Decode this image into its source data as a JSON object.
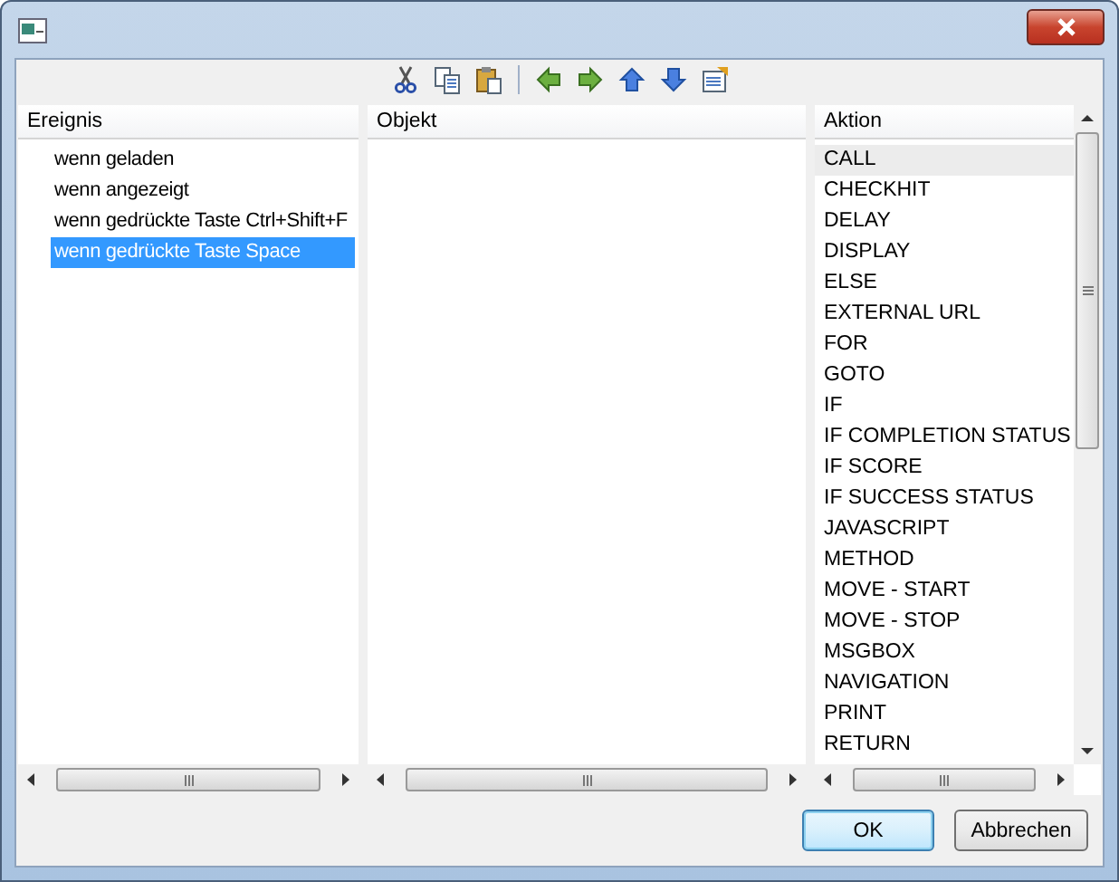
{
  "toolbar": [
    {
      "kind": "cut"
    },
    {
      "kind": "copy"
    },
    {
      "kind": "paste"
    },
    {
      "kind": "separator"
    },
    {
      "kind": "left"
    },
    {
      "kind": "right"
    },
    {
      "kind": "up"
    },
    {
      "kind": "down"
    },
    {
      "kind": "properties"
    }
  ],
  "events": {
    "header": "Ereignis",
    "items": [
      {
        "label": "wenn geladen",
        "selected": false
      },
      {
        "label": "wenn angezeigt",
        "selected": false
      },
      {
        "label": "wenn gedrückte Taste Ctrl+Shift+F",
        "selected": false
      },
      {
        "label": "wenn gedrückte Taste Space",
        "selected": true
      }
    ]
  },
  "objects": {
    "header": "Objekt"
  },
  "actions": {
    "header": "Aktion",
    "items": [
      {
        "label": "CALL",
        "highlighted": true
      },
      {
        "label": "CHECKHIT",
        "highlighted": false
      },
      {
        "label": "DELAY",
        "highlighted": false
      },
      {
        "label": "DISPLAY",
        "highlighted": false
      },
      {
        "label": "ELSE",
        "highlighted": false
      },
      {
        "label": "EXTERNAL URL",
        "highlighted": false
      },
      {
        "label": "FOR",
        "highlighted": false
      },
      {
        "label": "GOTO",
        "highlighted": false
      },
      {
        "label": "IF",
        "highlighted": false
      },
      {
        "label": "IF COMPLETION STATUS",
        "highlighted": false
      },
      {
        "label": "IF SCORE",
        "highlighted": false
      },
      {
        "label": "IF SUCCESS STATUS",
        "highlighted": false
      },
      {
        "label": "JAVASCRIPT",
        "highlighted": false
      },
      {
        "label": "METHOD",
        "highlighted": false
      },
      {
        "label": "MOVE - START",
        "highlighted": false
      },
      {
        "label": "MOVE - STOP",
        "highlighted": false
      },
      {
        "label": "MSGBOX",
        "highlighted": false
      },
      {
        "label": "NAVIGATION",
        "highlighted": false
      },
      {
        "label": "PRINT",
        "highlighted": false
      },
      {
        "label": "RETURN",
        "highlighted": false
      }
    ]
  },
  "buttons": [
    {
      "label": "OK",
      "default": true
    },
    {
      "label": "Abbrechen",
      "default": false
    }
  ]
}
